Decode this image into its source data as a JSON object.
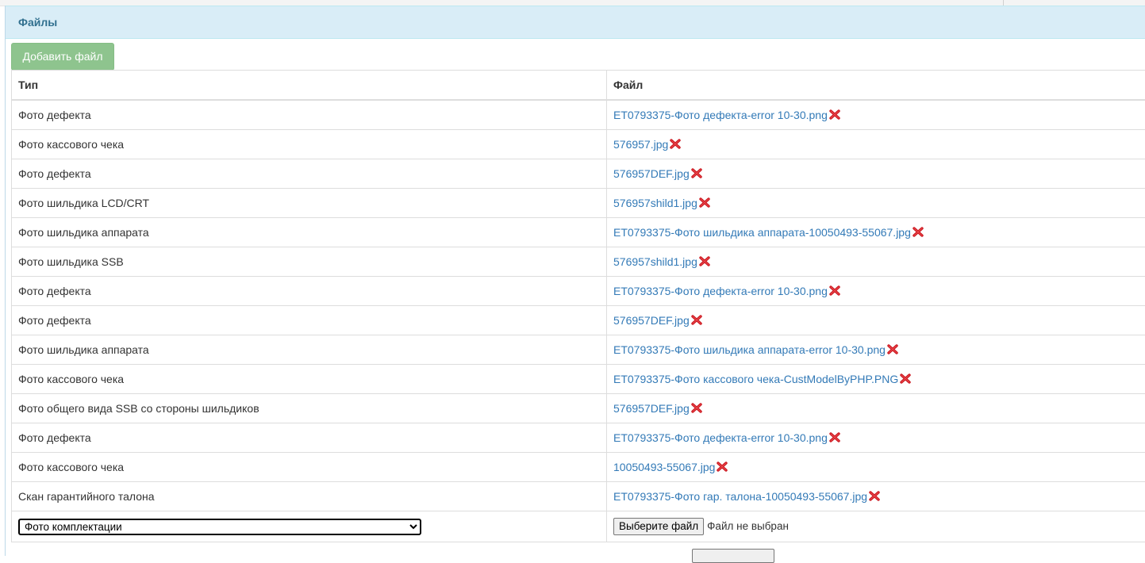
{
  "panel": {
    "title": "Файлы"
  },
  "toolbar": {
    "add_label": "Добавить файл"
  },
  "table": {
    "headers": {
      "type": "Тип",
      "file": "Файл"
    },
    "rows": [
      {
        "type": "Фото дефекта",
        "file": "ET0793375-Фото дефекта-error 10-30.png"
      },
      {
        "type": "Фото кассового чека",
        "file": "576957.jpg"
      },
      {
        "type": "Фото дефекта",
        "file": "576957DEF.jpg"
      },
      {
        "type": "Фото шильдика LCD/CRT",
        "file": "576957shild1.jpg"
      },
      {
        "type": "Фото шильдика аппарата",
        "file": "ET0793375-Фото шильдика аппарата-10050493-55067.jpg"
      },
      {
        "type": "Фото шильдика SSB",
        "file": "576957shild1.jpg"
      },
      {
        "type": "Фото дефекта",
        "file": "ET0793375-Фото дефекта-error 10-30.png"
      },
      {
        "type": "Фото дефекта",
        "file": "576957DEF.jpg"
      },
      {
        "type": "Фото шильдика аппарата",
        "file": "ET0793375-Фото шильдика аппарата-error 10-30.png"
      },
      {
        "type": "Фото кассового чека",
        "file": "ET0793375-Фото кассового чека-CustModelByPHP.PNG"
      },
      {
        "type": "Фото общего вида SSB со стороны шильдиков",
        "file": "576957DEF.jpg"
      },
      {
        "type": "Фото дефекта",
        "file": "ET0793375-Фото дефекта-error 10-30.png"
      },
      {
        "type": "Фото кассового чека",
        "file": "10050493-55067.jpg"
      },
      {
        "type": "Скан гарантийного талона",
        "file": "ET0793375-Фото гар. талона-10050493-55067.jpg"
      }
    ]
  },
  "new_row": {
    "type_selected": "Фото комплектации",
    "choose_file_label": "Выберите файл",
    "no_file_text": "Файл не выбран"
  },
  "icons": {
    "delete": "delete-x-icon"
  },
  "colors": {
    "link": "#337ab7",
    "delete": "#c9141c",
    "add_button": "#8ec48e",
    "heading_bg": "#d9edf7",
    "heading_text": "#31708f"
  }
}
